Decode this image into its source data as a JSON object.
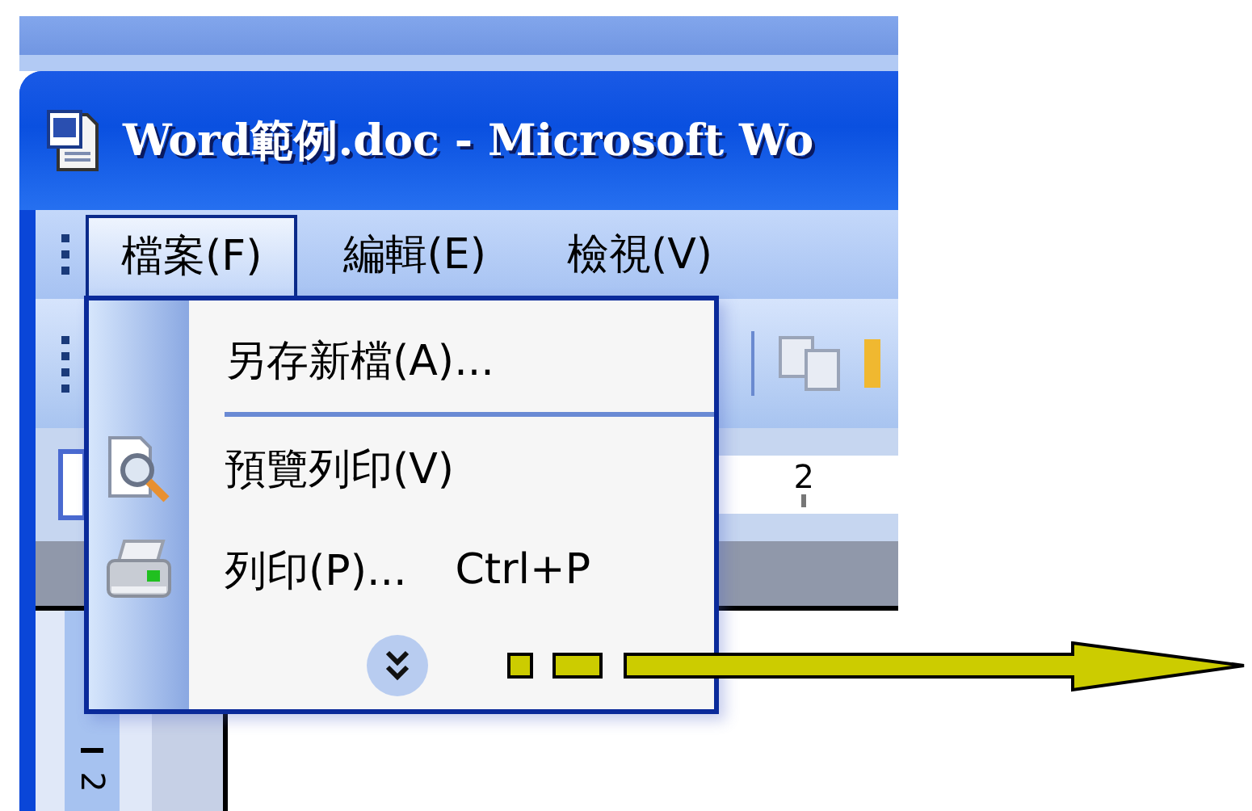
{
  "window": {
    "title": "Word範例.doc - Microsoft Wo"
  },
  "menu_bar": [
    {
      "label": "檔案(F)",
      "selected": true
    },
    {
      "label": "編輯(E)",
      "selected": false
    },
    {
      "label": "檢視(V)",
      "selected": false
    }
  ],
  "file_menu": [
    {
      "kind": "item",
      "label": "另存新檔(A)..."
    },
    {
      "kind": "separator"
    },
    {
      "kind": "item",
      "label": "預覽列印(V)"
    },
    {
      "kind": "item",
      "label": "列印(P)...",
      "shortcut": "Ctrl+P"
    },
    {
      "kind": "expand"
    }
  ],
  "rulers": {
    "horizontal_mark": "2",
    "vertical_mark": "2"
  }
}
